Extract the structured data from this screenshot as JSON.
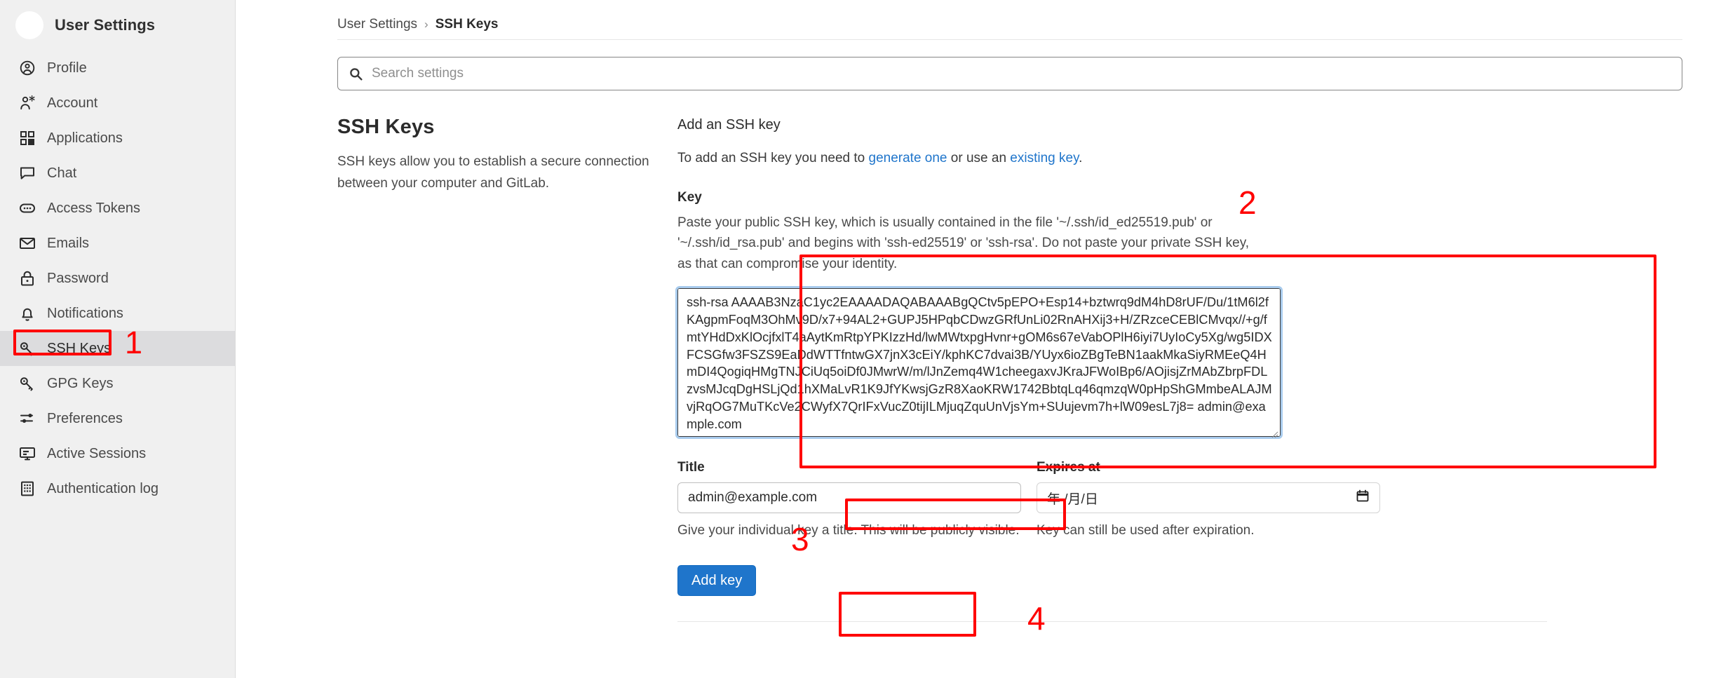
{
  "sidebar": {
    "title": "User Settings",
    "items": [
      {
        "label": "Profile",
        "icon": "user-circle-icon",
        "active": false
      },
      {
        "label": "Account",
        "icon": "user-gear-icon",
        "active": false
      },
      {
        "label": "Applications",
        "icon": "grid-squares-icon",
        "active": false
      },
      {
        "label": "Chat",
        "icon": "chat-bubble-icon",
        "active": false
      },
      {
        "label": "Access Tokens",
        "icon": "token-pill-icon",
        "active": false
      },
      {
        "label": "Emails",
        "icon": "envelope-icon",
        "active": false
      },
      {
        "label": "Password",
        "icon": "lock-icon",
        "active": false
      },
      {
        "label": "Notifications",
        "icon": "bell-icon",
        "active": false
      },
      {
        "label": "SSH Keys",
        "icon": "key-icon",
        "active": true
      },
      {
        "label": "GPG Keys",
        "icon": "key-icon",
        "active": false
      },
      {
        "label": "Preferences",
        "icon": "sliders-icon",
        "active": false
      },
      {
        "label": "Active Sessions",
        "icon": "monitor-icon",
        "active": false
      },
      {
        "label": "Authentication log",
        "icon": "log-grid-icon",
        "active": false
      }
    ]
  },
  "breadcrumb": {
    "parent": "User Settings",
    "separator": "›",
    "current": "SSH Keys"
  },
  "search": {
    "placeholder": "Search settings",
    "value": "",
    "icon": "search-icon"
  },
  "section": {
    "heading": "SSH Keys",
    "description": "SSH keys allow you to establish a secure connection between your computer and GitLab."
  },
  "form": {
    "title": "Add an SSH key",
    "intro_prefix": "To add an SSH key you need to ",
    "intro_link1": "generate one",
    "intro_middle": " or use an ",
    "intro_link2": "existing key",
    "intro_suffix": ".",
    "key_label": "Key",
    "key_help": "Paste your public SSH key, which is usually contained in the file '~/.ssh/id_ed25519.pub' or '~/.ssh/id_rsa.pub' and begins with 'ssh-ed25519' or 'ssh-rsa'. Do not paste your private SSH key, as that can compromise your identity.",
    "key_value": "ssh-rsa AAAAB3NzaC1yc2EAAAADAQABAAABgQCtv5pEPO+Esp14+bztwrq9dM4hD8rUF/Du/1tM6l2fKAgpmFoqM3OhMv9D/x7+94AL2+GUPJ5HPqbCDwzGRfUnLi02RnAHXij3+H/ZRzceCEBlCMvqx//+g/fmtYHdDxKlOcjfxlT4aAytKmRtpYPKIzzHd/lwMWtxpgHvnr+gOM6s67eVabOPlH6iyi7UyIoCy5Xg/wg5IDXFCSGfw3FSZS9EaDdWTTfntwGX7jnX3cEiY/kphKC7dvai3B/YUyx6ioZBgTeBN1aakMkaSiyRMEeQ4HmDI4QogiqHMgTNJCiUq5oiDf0JMwrW/m/lJnZemq4W1cheegaxvJKraJFWoIBp6/AOjisjZrMAbZbrpFDLzvsMJcqDgHSLjQd1hXMaLvR1K9JfYKwsjGzR8XaoKRW1742BbtqLq46qmzqW0pHpShGMmbeALAJMvjRqOG7MuTKcVe2CWyfX7QrIFxVucZ0tijILMjuqZquUnVjsYm+SUujevm7h+lW09esL7j8= admin@example.com",
    "title_label": "Title",
    "title_value": "admin@example.com",
    "title_hint": "Give your individual key a title. This will be publicly visible.",
    "expires_label": "Expires at",
    "expires_placeholder": "年 /月/日",
    "expires_icon": "calendar-icon",
    "expires_hint": "Key can still be used after expiration.",
    "submit_label": "Add key"
  },
  "annotations": {
    "color": "#ff0000",
    "markers": [
      {
        "number": "1"
      },
      {
        "number": "2"
      },
      {
        "number": "3"
      },
      {
        "number": "4"
      }
    ]
  }
}
